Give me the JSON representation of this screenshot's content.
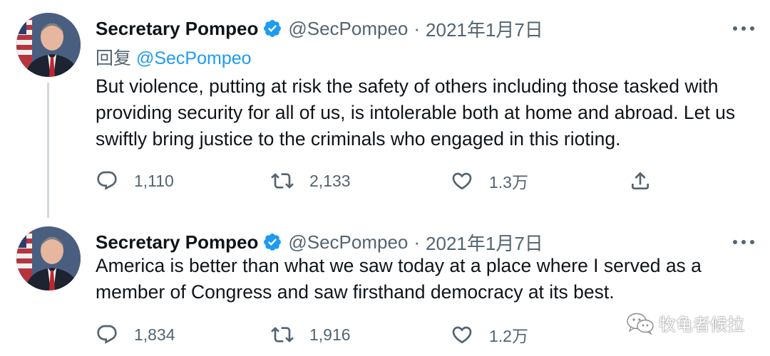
{
  "thread": {
    "tweets": [
      {
        "author_name": "Secretary Pompeo",
        "handle": "@SecPompeo",
        "separator": "·",
        "date": "2021年1月7日",
        "reply_prefix": "回复",
        "reply_to": "@SecPompeo",
        "text": "But violence, putting at risk the safety of others including those tasked with providing security for all of us, is intolerable both at home and abroad. Let us swiftly bring justice to the criminals who engaged in this rioting.",
        "replies": "1,110",
        "retweets": "2,133",
        "likes": "1.3万",
        "icons": [
          "verified-badge-icon",
          "more-icon",
          "reply-icon",
          "retweet-icon",
          "like-icon",
          "share-icon"
        ]
      },
      {
        "author_name": "Secretary Pompeo",
        "handle": "@SecPompeo",
        "separator": "·",
        "date": "2021年1月7日",
        "text": "America is better than what we saw today at a place where I served as a member of Congress and saw firsthand democracy at its best.",
        "replies": "1,834",
        "retweets": "1,916",
        "likes": "1.2万"
      }
    ]
  },
  "watermark": {
    "text": "牧龟者候拉",
    "icon": "wechat-icon"
  },
  "colors": {
    "text_primary": "#0f1419",
    "text_secondary": "#536471",
    "accent_blue": "#1d9bf0",
    "thread_line": "#cfd9de"
  }
}
